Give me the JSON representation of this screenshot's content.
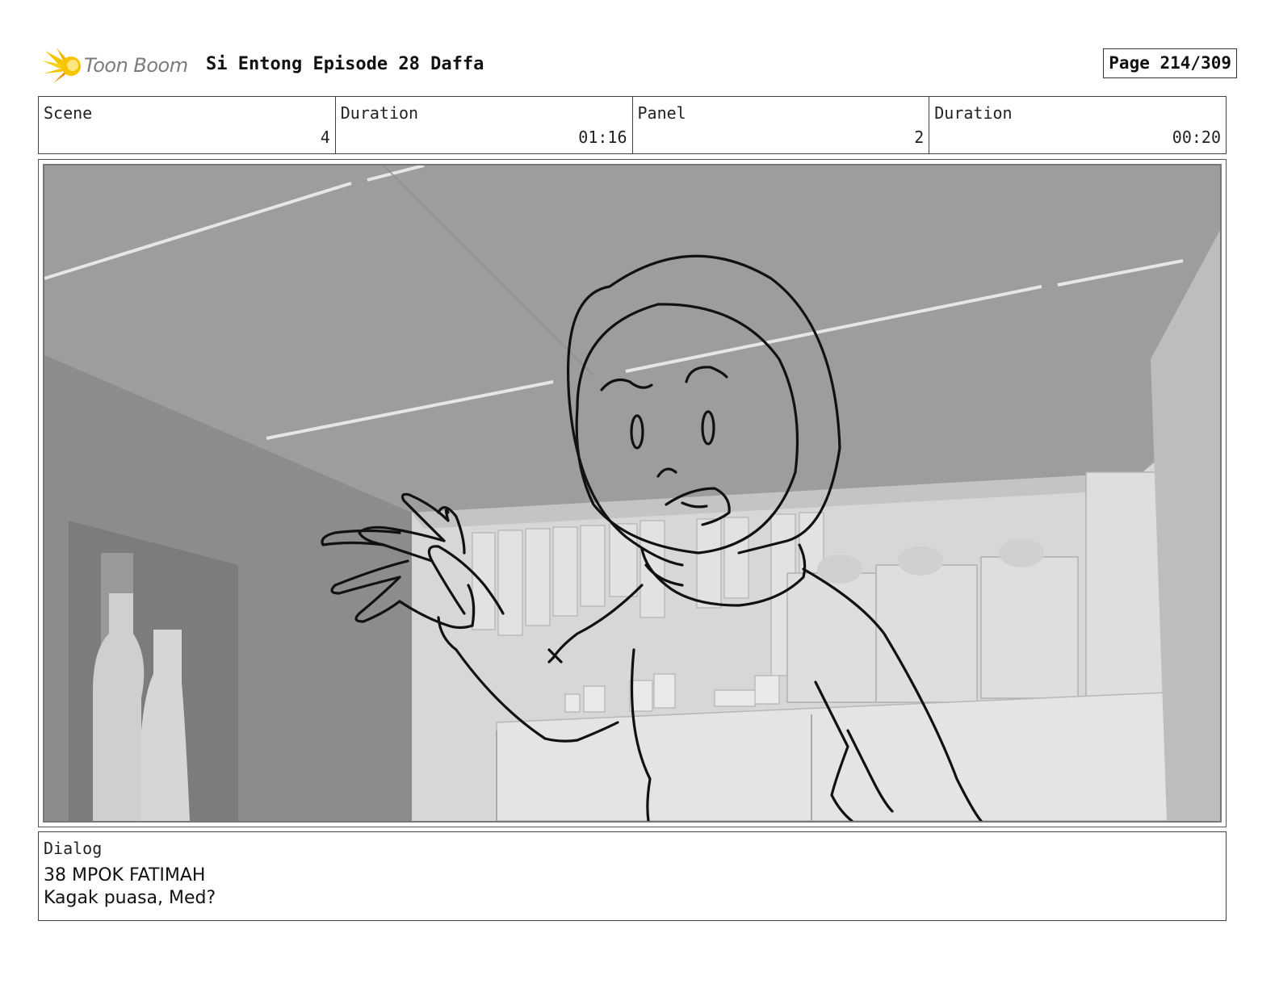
{
  "header": {
    "logo_text": "Toon Boom",
    "project_title": "Si Entong Episode 28 Daffa",
    "page_label": "Page 214/309"
  },
  "info": [
    {
      "label": "Scene",
      "value": "4"
    },
    {
      "label": "Duration",
      "value": "01:16"
    },
    {
      "label": "Panel",
      "value": "2"
    },
    {
      "label": "Duration",
      "value": "00:20"
    }
  ],
  "panel": {
    "description": ""
  },
  "dialog": {
    "label": "Dialog",
    "line1": "38 MPOK FATIMAH",
    "line2": "Kagak puasa, Med?"
  },
  "colors": {
    "logo_yellow": "#f5c400",
    "logo_orange": "#f08a00"
  }
}
